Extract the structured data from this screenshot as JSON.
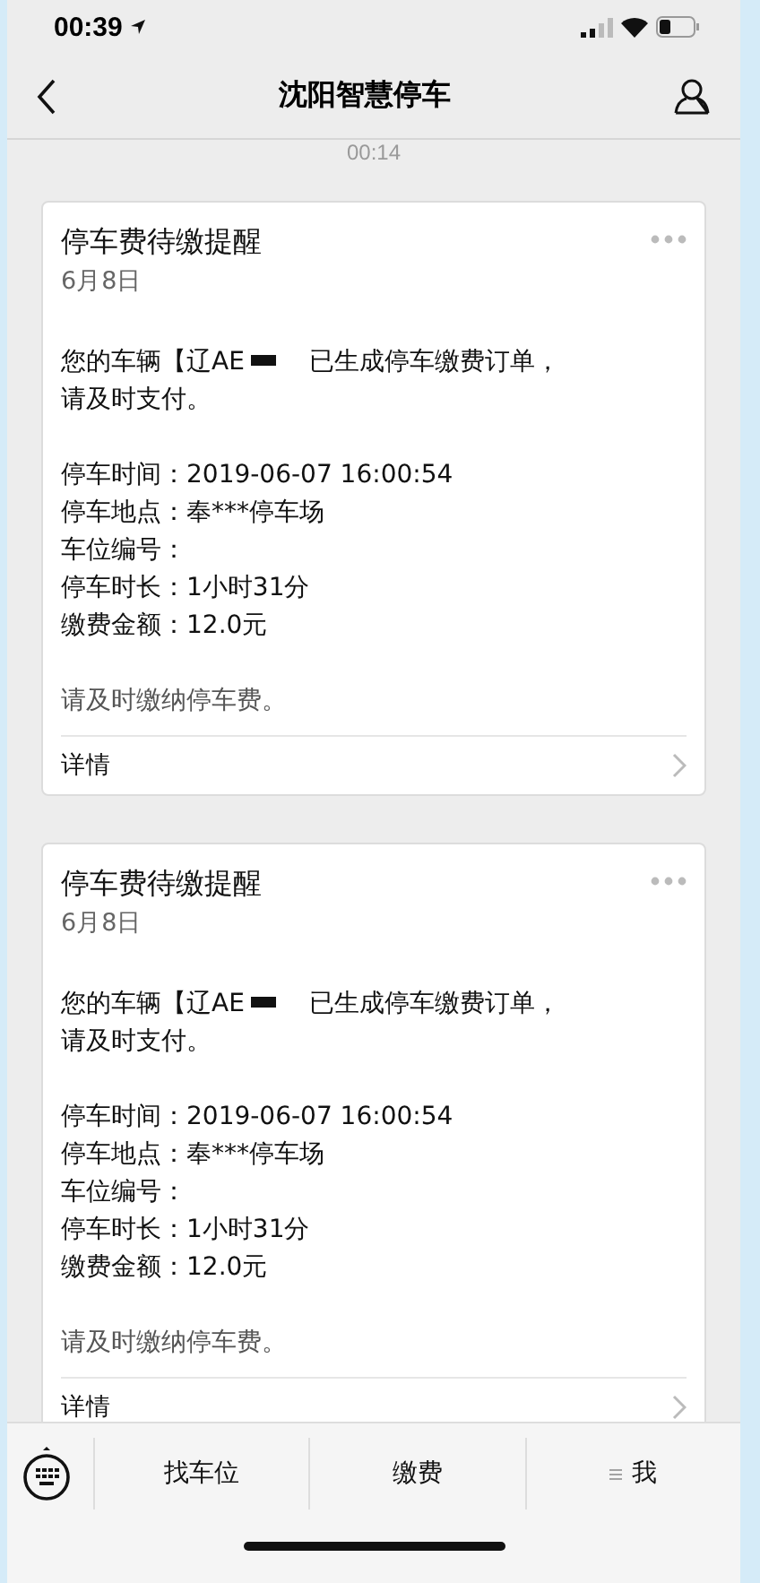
{
  "status_bar": {
    "time": "00:39"
  },
  "nav": {
    "title": "沈阳智慧停车"
  },
  "timestamp": "00:14",
  "cards": [
    {
      "title": "停车费待缴提醒",
      "date": "6月8日",
      "plate": "您的车辆【辽AE",
      "message": "已生成停车缴费订单，",
      "message_cont": "请及时支付。",
      "fields": [
        {
          "label": "停车时间：",
          "value": "2019-06-07 16:00:54"
        },
        {
          "label": "停车地点：",
          "value": "奉***停车场"
        },
        {
          "label": "车位编号："
        },
        {
          "label": "停车时长：",
          "value": "1小时31分"
        },
        {
          "label": "缴费金额：",
          "value": "12.0元"
        }
      ],
      "note": "请及时缴纳停车费。",
      "link": "详情"
    },
    {
      "title": "停车费待缴提醒",
      "date": "6月8日",
      "plate": "您的车辆【辽AE",
      "message": "已生成停车缴费订单，",
      "message_cont": "请及时支付。",
      "fields": [
        {
          "label": "停车时间：",
          "value": "2019-06-07 16:00:54"
        },
        {
          "label": "停车地点：",
          "value": "奉***停车场"
        },
        {
          "label": "车位编号："
        },
        {
          "label": "停车时长：",
          "value": "1小时31分"
        },
        {
          "label": "缴费金额：",
          "value": "12.0元"
        }
      ],
      "note": "请及时缴纳停车费。",
      "link": "详情"
    }
  ],
  "menu": [
    {
      "label": "找车位",
      "kind": "plain"
    },
    {
      "label": "缴费",
      "kind": "plain"
    },
    {
      "label": "我",
      "kind": "submenu"
    }
  ]
}
